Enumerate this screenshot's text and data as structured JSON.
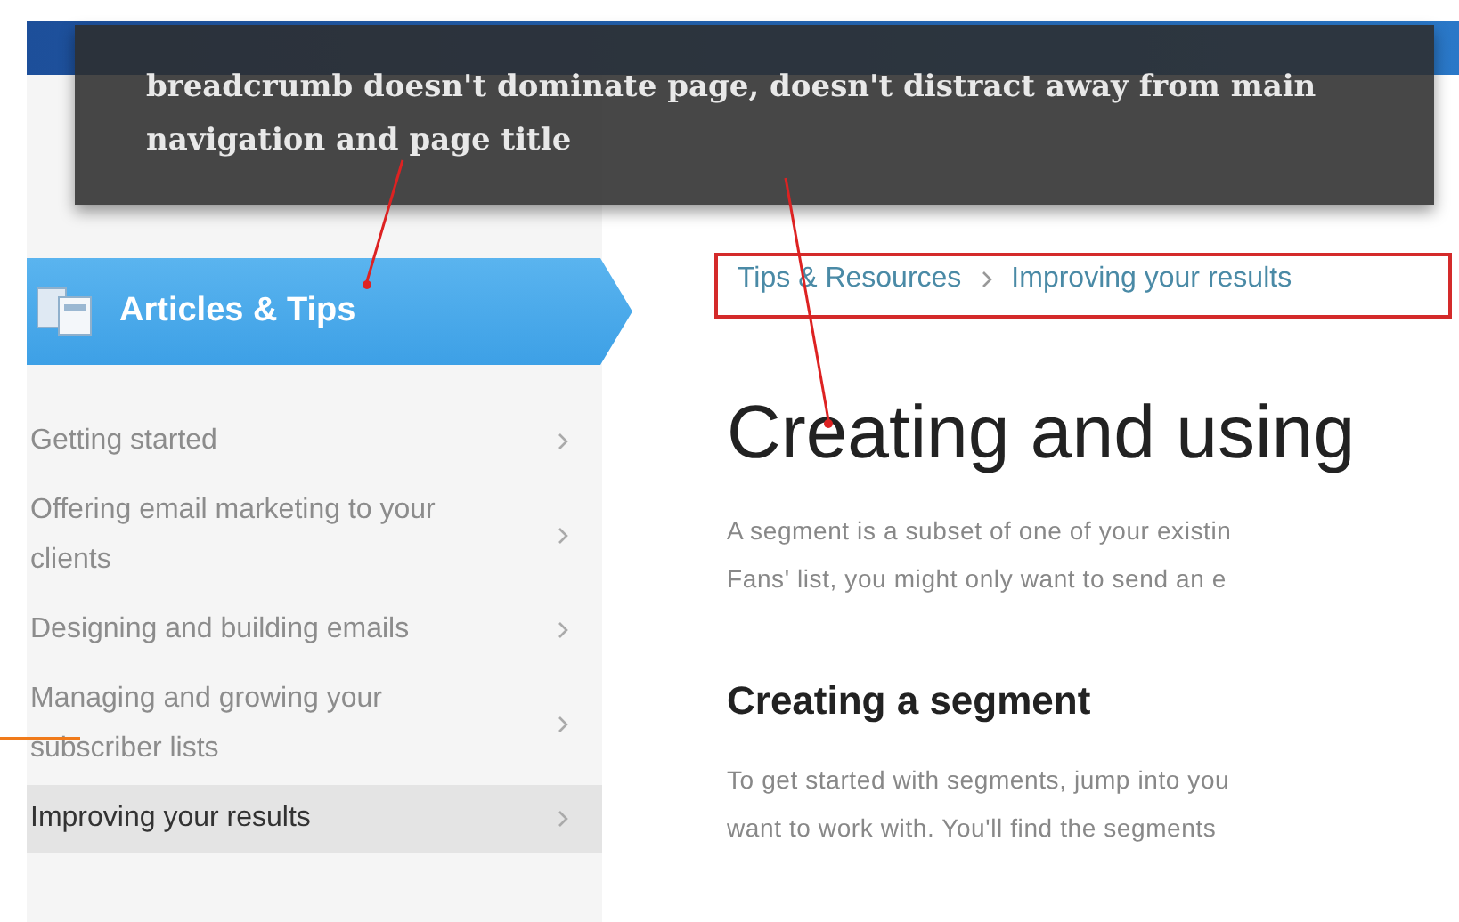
{
  "annotation": {
    "text": "breadcrumb doesn't dominate page, doesn't distract away from main navigation and page title"
  },
  "sidebar": {
    "title": "Articles & Tips",
    "items": [
      {
        "label": "Getting started",
        "selected": false
      },
      {
        "label": "Offering email marketing to your clients",
        "selected": false
      },
      {
        "label": "Designing and building emails",
        "selected": false
      },
      {
        "label": "Managing and growing your subscriber lists",
        "selected": false
      },
      {
        "label": "Improving your results",
        "selected": true
      }
    ]
  },
  "breadcrumb": [
    "Tips & Resources",
    "Improving your results"
  ],
  "article": {
    "title": "Creating and using",
    "intro": [
      "A segment is a subset of one of your existin",
      "Fans' list, you might only want to send an e"
    ],
    "heading": "Creating a segment",
    "body": [
      "To get started with segments, jump into you",
      "want to work with. You'll find the segments"
    ]
  }
}
